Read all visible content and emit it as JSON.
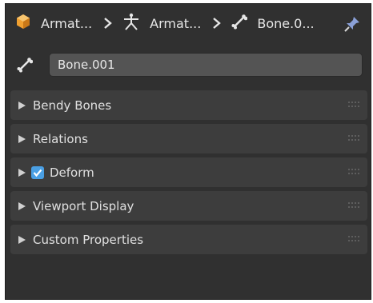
{
  "breadcrumb": {
    "items": [
      {
        "label": "Armat...",
        "icon": "armature-object-icon"
      },
      {
        "label": "Armat...",
        "icon": "armature-data-icon"
      },
      {
        "label": "Bone.0...",
        "icon": "bone-icon"
      }
    ],
    "separator_icon": "chevron-right-icon",
    "pin_icon": "pin-icon"
  },
  "bone_name": {
    "icon": "bone-icon",
    "value": "Bone.001"
  },
  "panels": [
    {
      "label": "Bendy Bones",
      "expanded": false
    },
    {
      "label": "Relations",
      "expanded": false
    },
    {
      "label": "Deform",
      "expanded": false,
      "checkbox": true,
      "checked": true
    },
    {
      "label": "Viewport Display",
      "expanded": false
    },
    {
      "label": "Custom Properties",
      "expanded": false
    }
  ],
  "colors": {
    "background": "#303030",
    "panel": "#3d3d3d",
    "field": "#545454",
    "accent": "#4a9fe3",
    "object_orange": "#f0a030"
  }
}
